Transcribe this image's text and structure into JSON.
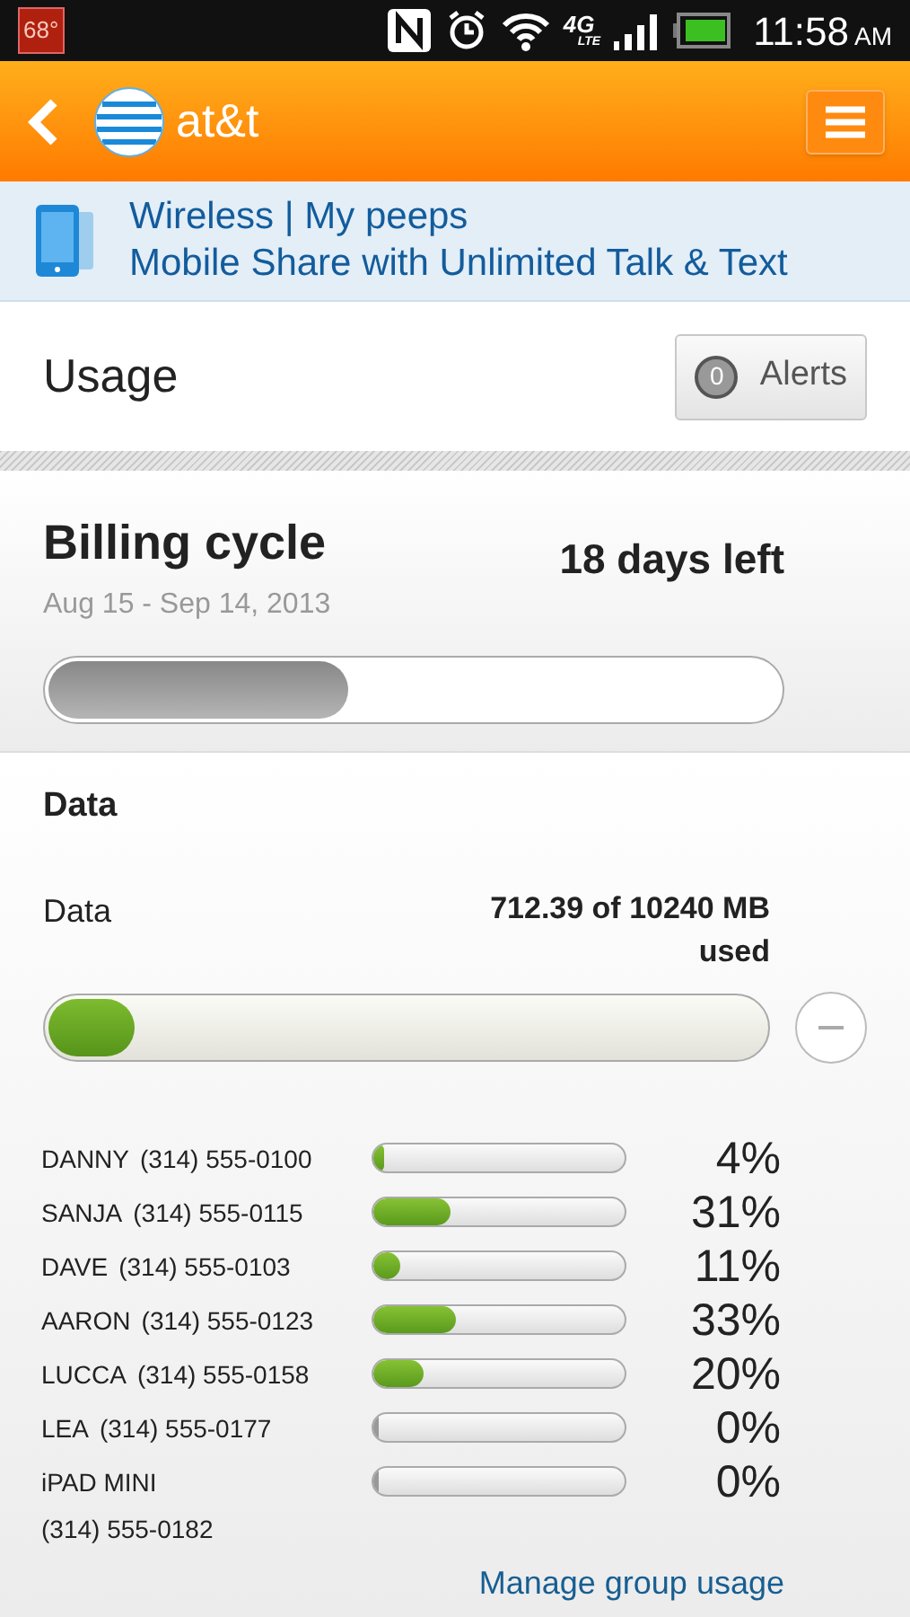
{
  "status_bar": {
    "temperature": "68°",
    "network": "4G",
    "network_sub": "LTE",
    "time": "11:58",
    "meridiem": "AM"
  },
  "header": {
    "logo_text": "at&t"
  },
  "plan": {
    "line1": "Wireless | My peeps",
    "line2": "Mobile Share with Unlimited Talk & Text"
  },
  "usage": {
    "title": "Usage",
    "alerts_count": "0",
    "alerts_label": "Alerts"
  },
  "billing": {
    "title": "Billing cycle",
    "dates": "Aug 15 - Sep 14, 2013",
    "remaining": "18 days left",
    "level": 0.41
  },
  "data": {
    "section_title": "Data",
    "label": "Data",
    "amount": "712.39 of 10240 MB used",
    "level": 0.12,
    "expanded": true
  },
  "members": [
    {
      "kind": "phone",
      "name": "DANNY",
      "number": "(314) 555-0100",
      "level": 0.04,
      "percent": "4%"
    },
    {
      "kind": "phone",
      "name": "SANJA",
      "number": "(314) 555-0115",
      "level": 0.31,
      "percent": "31%"
    },
    {
      "kind": "phone",
      "name": "DAVE",
      "number": "(314) 555-0103",
      "level": 0.11,
      "percent": "11%"
    },
    {
      "kind": "phone",
      "name": "AARON",
      "number": "(314) 555-0123",
      "level": 0.33,
      "percent": "33%"
    },
    {
      "kind": "phone",
      "name": "LUCCA",
      "number": "(314) 555-0158",
      "level": 0.2,
      "percent": "20%"
    },
    {
      "kind": "phone",
      "name": "LEA",
      "number": "(314) 555-0177",
      "level": 0,
      "percent": "0%"
    },
    {
      "kind": "tablet",
      "name": "iPAD MINI",
      "number": "(314) 555-0182",
      "level": 0,
      "percent": "0%"
    }
  ],
  "manage_link": "Manage group usage"
}
